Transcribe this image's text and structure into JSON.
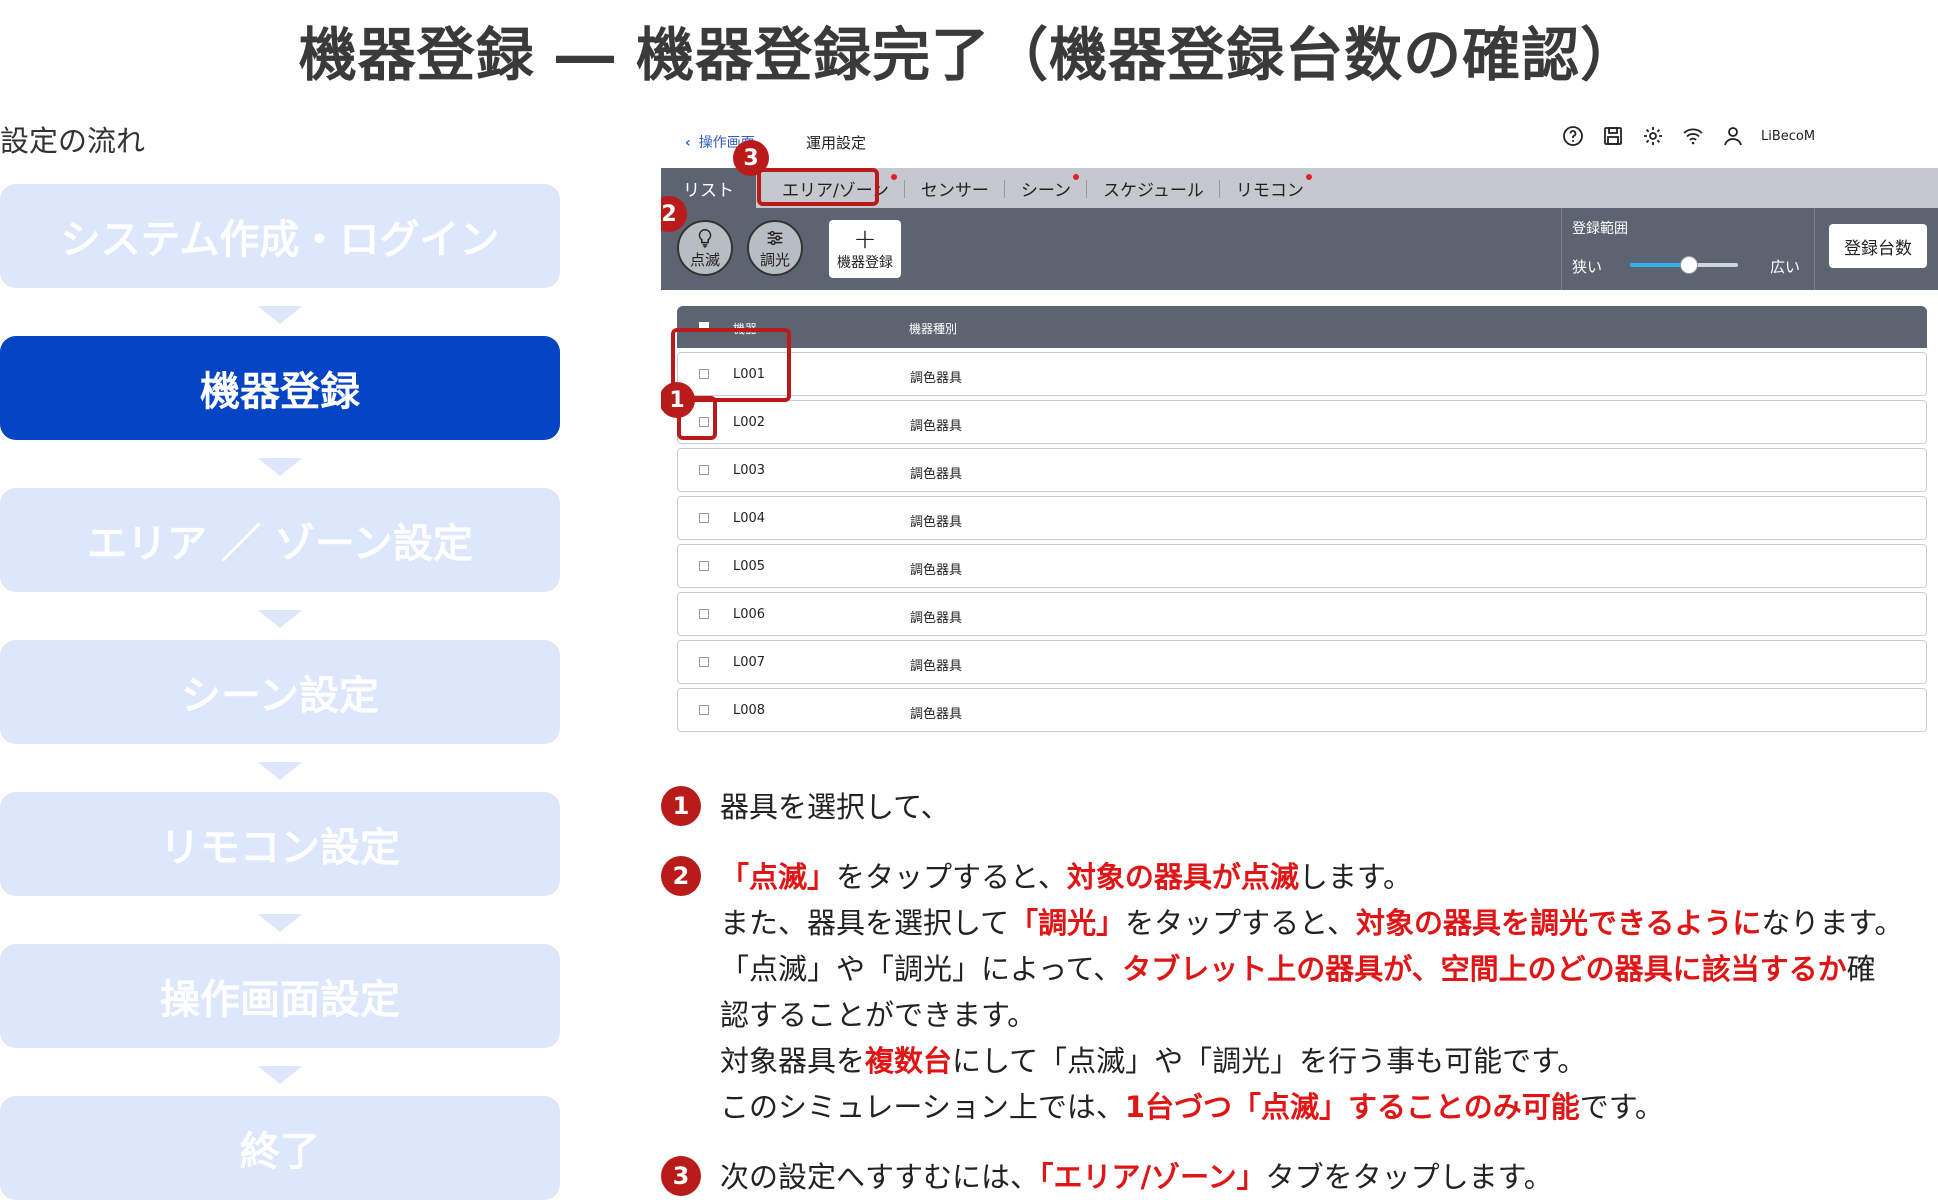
{
  "title": "機器登録 ― 機器登録完了（機器登録台数の確認）",
  "flow": {
    "label": "設定の流れ",
    "steps": [
      {
        "label": "システム作成・ログイン",
        "active": false
      },
      {
        "label": "機器登録",
        "active": true
      },
      {
        "label": "エリア ／ ゾーン設定",
        "active": false
      },
      {
        "label": "シーン設定",
        "active": false
      },
      {
        "label": "リモコン設定",
        "active": false
      },
      {
        "label": "操作画面設定",
        "active": false
      },
      {
        "label": "終了",
        "active": false
      }
    ]
  },
  "app": {
    "header": {
      "back_label": "操作画面",
      "title": "運用設定",
      "user_name": "LiBecoM",
      "icons": [
        "help-icon",
        "save-icon",
        "gear-icon",
        "wifi-icon",
        "user-icon"
      ]
    },
    "tabs": [
      {
        "label": "リスト",
        "active": true,
        "dot": false
      },
      {
        "label": "エリア/ゾーン",
        "active": false,
        "dot": true
      },
      {
        "label": "センサー",
        "active": false,
        "dot": false
      },
      {
        "label": "シーン",
        "active": false,
        "dot": true
      },
      {
        "label": "スケジュール",
        "active": false,
        "dot": false
      },
      {
        "label": "リモコン",
        "active": false,
        "dot": true
      }
    ],
    "toolbar": {
      "blink_label": "点滅",
      "dim_label": "調光",
      "add_label": "機器登録",
      "range_title": "登録範囲",
      "range_min_label": "狭い",
      "range_max_label": "広い",
      "range_value": 0.55,
      "count_button": "登録台数"
    },
    "table": {
      "columns": [
        "機器",
        "機器種別"
      ],
      "rows": [
        {
          "device": "L001",
          "type": "調色器具"
        },
        {
          "device": "L002",
          "type": "調色器具"
        },
        {
          "device": "L003",
          "type": "調色器具"
        },
        {
          "device": "L004",
          "type": "調色器具"
        },
        {
          "device": "L005",
          "type": "調色器具"
        },
        {
          "device": "L006",
          "type": "調色器具"
        },
        {
          "device": "L007",
          "type": "調色器具"
        },
        {
          "device": "L008",
          "type": "調色器具"
        }
      ]
    }
  },
  "annotations": {
    "m1": "1",
    "m2": "2",
    "m3": "3"
  },
  "notes": {
    "n1": "器具を選択して、",
    "n2_red1": "「点滅」",
    "n2_t1": "をタップすると、",
    "n2_red2": "対象の器具が点滅",
    "n2_t2": "します。",
    "n3_t1": "また、器具を選択して",
    "n3_red1": "「調光」",
    "n3_t2": "をタップすると、",
    "n3_red2": "対象の器具を調光できるように",
    "n3_t3": "なります。",
    "n4_t1": "「点滅」や「調光」によって、",
    "n4_red1": "タブレット上の器具が、空間上のどの器具に該当するか",
    "n4_t2": "確",
    "n5": "認することができます。",
    "n6_t1": "対象器具を",
    "n6_red1": "複数台",
    "n6_t2": "にして「点滅」や「調光」を行う事も可能です。",
    "n7_t1": "このシミュレーション上では、",
    "n7_red1": "1台づつ「点滅」することのみ可能",
    "n7_t2": "です。",
    "n8_t1": "次の設定へすすむには、",
    "n8_red1": "「エリア/ゾーン」",
    "n8_t2": "タブをタップします。"
  },
  "colors": {
    "accent": "#0544c4",
    "step_inactive": "#dde7fb",
    "annotation_red": "#b91b1b",
    "emphasis_red": "#e01616",
    "toolbar_gray": "#5b6470"
  }
}
